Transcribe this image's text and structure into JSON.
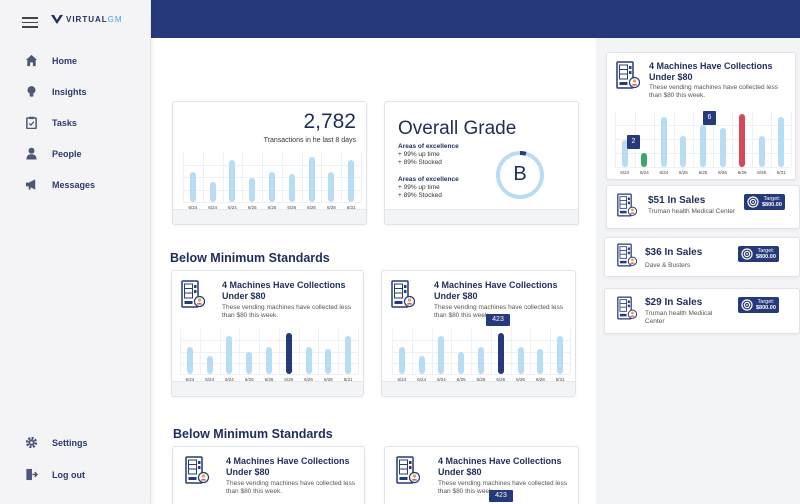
{
  "brand": {
    "name_bold": "VIRTUAL",
    "name_accent": "GM"
  },
  "nav": {
    "items": [
      {
        "label": "Home",
        "icon": "home-icon"
      },
      {
        "label": "Insights",
        "icon": "lightbulb-icon"
      },
      {
        "label": "Tasks",
        "icon": "clipboard-icon"
      },
      {
        "label": "People",
        "icon": "person-icon"
      },
      {
        "label": "Messages",
        "icon": "megaphone-icon"
      }
    ],
    "settings_label": "Settings",
    "logout_label": "Log out"
  },
  "colors": {
    "navy": "#26397a",
    "light_bar": "#b9dcf5",
    "green": "#3ea46d",
    "red": "#d8475c"
  },
  "transactions": {
    "value": "2,782",
    "caption": "Transactions in he last 8 days",
    "chart_data": {
      "type": "bar",
      "categories": [
        "6/24",
        "6/24",
        "6/24",
        "6/25",
        "6/25",
        "6/26",
        "6/26",
        "6/28",
        "6/31"
      ],
      "values": [
        30,
        20,
        42,
        24,
        30,
        28,
        45,
        30,
        42
      ],
      "highlight": []
    }
  },
  "grade": {
    "title": "Overall Grade",
    "letter": "B",
    "sections": [
      {
        "heading": "Areas of excellence",
        "lines": [
          "+ 99% up time",
          "+ 89% Stocked"
        ]
      },
      {
        "heading": "Areas of excellence",
        "lines": [
          "+ 99% up time",
          "+ 89% Stocked"
        ]
      }
    ]
  },
  "sections": [
    {
      "title": "Below Minimum Standards"
    },
    {
      "title": "Below Minimum Standards"
    }
  ],
  "machine_cards": [
    {
      "title": "4 Machines Have Collections Under $80",
      "subtitle": "These vending machines have collected less than $80 this week.",
      "chart_data": {
        "type": "bar",
        "categories": [
          "6/24",
          "6/24",
          "6/24",
          "6/25",
          "6/25",
          "6/26",
          "6/26",
          "6/28",
          "6/31"
        ],
        "values": [
          30,
          20,
          42,
          24,
          30,
          45,
          30,
          28,
          42
        ],
        "highlight_index": 5
      }
    },
    {
      "title": "4 Machines Have Collections Under $80",
      "subtitle": "These vending machines have collected less than $80 this week.",
      "tooltip": "423",
      "chart_data": {
        "type": "bar",
        "categories": [
          "6/24",
          "6/24",
          "6/24",
          "6/25",
          "6/25",
          "6/26",
          "6/26",
          "6/28",
          "6/31"
        ],
        "values": [
          30,
          20,
          42,
          24,
          30,
          45,
          30,
          28,
          42
        ],
        "highlight_index": 5
      }
    },
    {
      "title": "4 Machines Have Collections Under $80",
      "subtitle": "These vending machines have collected less than $80 this week."
    },
    {
      "title": "4 Machines Have Collections Under $80",
      "subtitle": "These vending machines have collected less than $80 this week.",
      "tooltip": "423"
    }
  ],
  "right": {
    "top_card": {
      "title": "4 Machines Have Collections Under $80",
      "subtitle": "These vending machines have collected less than $80 this week.",
      "tooltip_green": "2",
      "tooltip_red": "6",
      "chart_data": {
        "type": "bar",
        "categories": [
          "6/24",
          "6/24",
          "6/24",
          "6/25",
          "6/25",
          "6/26",
          "6/26",
          "6/28",
          "6/31"
        ],
        "values": [
          28,
          14,
          52,
          32,
          44,
          40,
          55,
          32,
          52
        ],
        "green_index": 1,
        "red_index": 6
      }
    },
    "sales": [
      {
        "amount": "$51 In Sales",
        "location": "Truman health Medical Center",
        "target_label": "Target:",
        "target_value": "$800.00"
      },
      {
        "amount": "$36 In Sales",
        "location": "Dave & Busters",
        "target_label": "Target:",
        "target_value": "$800.00"
      },
      {
        "amount": "$29 In Sales",
        "location": "Truman health Mediical Center",
        "target_label": "Target:",
        "target_value": "$800.00"
      }
    ]
  }
}
